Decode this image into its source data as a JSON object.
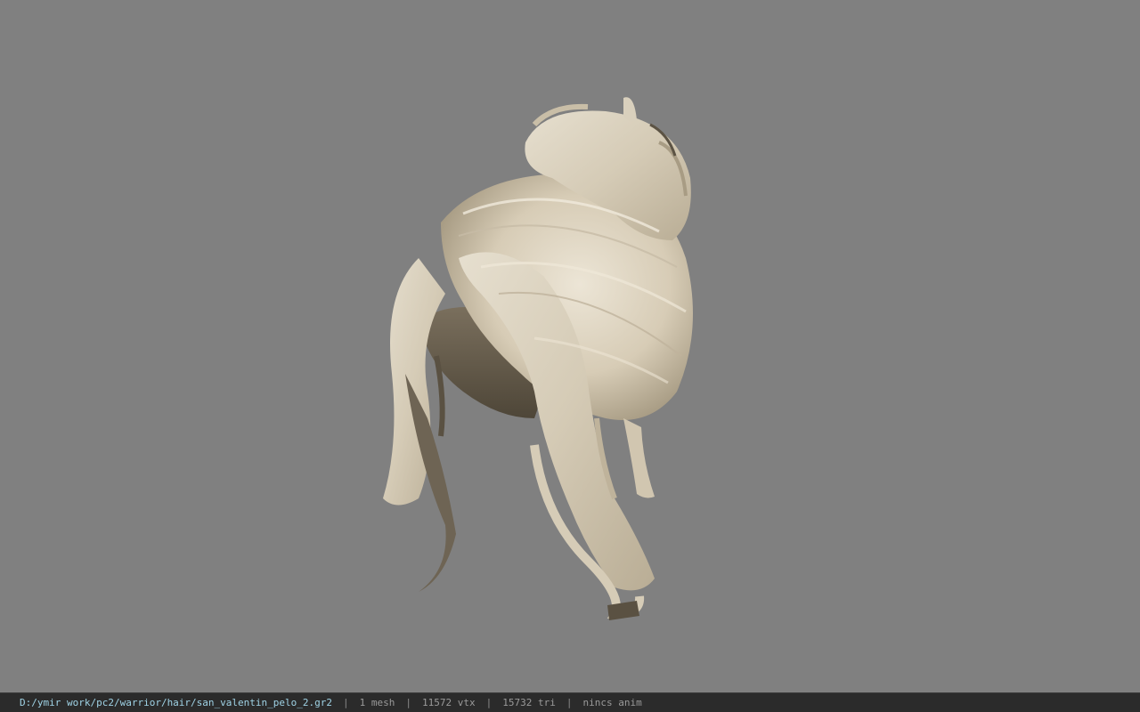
{
  "viewport": {
    "background_color": "#808080",
    "model_icon": "hair-mesh-preview"
  },
  "statusbar": {
    "file_path": "D:/ymir work/pc2/warrior/hair/san_valentin_pelo_2.gr2",
    "separator": "|",
    "mesh_count": "1 mesh",
    "vertex_count": "11572 vtx",
    "triangle_count": "15732 tri",
    "anim_status": "nincs anim",
    "path_color": "#9fd3e6"
  }
}
